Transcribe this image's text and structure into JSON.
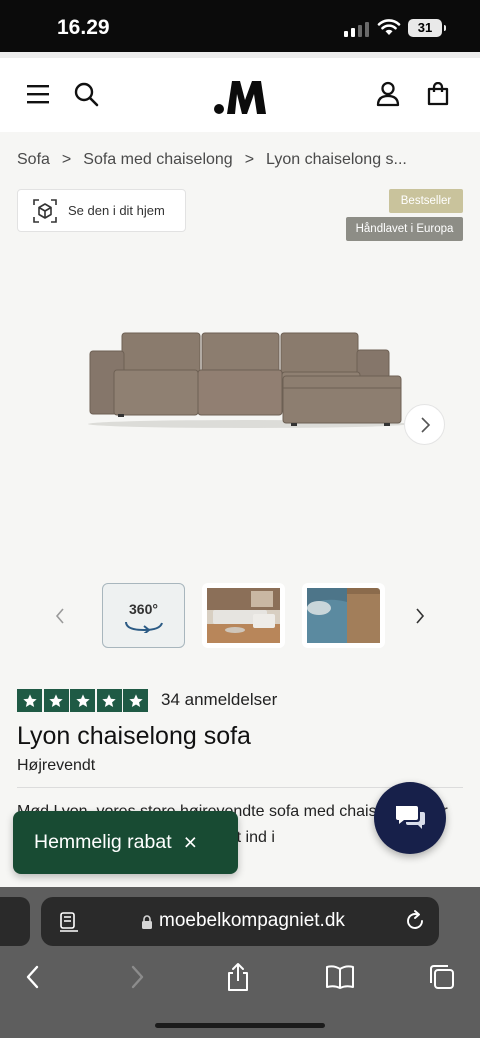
{
  "status_bar": {
    "time": "16.29",
    "battery": "31"
  },
  "header": {
    "logo": ".M"
  },
  "breadcrumb": [
    {
      "label": "Sofa"
    },
    {
      "label": "Sofa med chaiselong"
    },
    {
      "label": "Lyon chaiselong s..."
    }
  ],
  "breadcrumb_separator": ">",
  "view_home": {
    "label": "Se den i dit hjem",
    "icon": "ar-cube-icon"
  },
  "badges": {
    "bestseller": "Bestseller",
    "handmade": "Håndlavet i Europa"
  },
  "thumbnails": {
    "first_label": "360°"
  },
  "rating": {
    "stars": 5,
    "reviews": "34 anmeldelser"
  },
  "product": {
    "title": "Lyon chaiselong sofa",
    "variant": "Højrevendt",
    "description": "Mød Lyon, vores store højrevendte sofa med chaiselong, der strækker sig imponerende langt ind i"
  },
  "discount_popup": {
    "label": "Hemmelig rabat",
    "close": "×"
  },
  "browser": {
    "url": "moebelkompagniet.dk"
  },
  "colors": {
    "brand_green": "#184b33",
    "star_green": "#1f5a45",
    "chat_navy": "#17204a",
    "badge_bestseller": "#c9c39c",
    "badge_handmade": "#8d8d86"
  }
}
